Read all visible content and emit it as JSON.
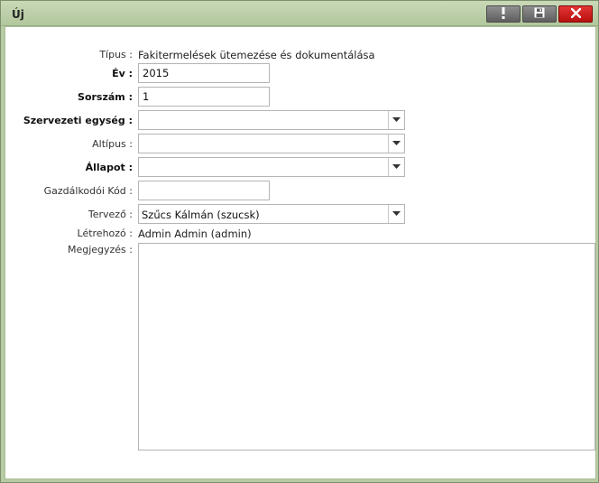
{
  "window": {
    "title": "Új"
  },
  "form": {
    "tipus": {
      "label": "Típus :",
      "value": "Fakitermelések ütemezése és dokumentálása"
    },
    "ev": {
      "label": "Év :",
      "value": "2015"
    },
    "sorszam": {
      "label": "Sorszám :",
      "value": "1"
    },
    "szervezeti_egyseg": {
      "label": "Szervezeti egység :",
      "value": ""
    },
    "altipus": {
      "label": "Altípus :",
      "value": ""
    },
    "allapot": {
      "label": "Állapot :",
      "value": ""
    },
    "gazdalkodoi_kod": {
      "label": "Gazdálkodói Kód :",
      "value": ""
    },
    "tervezo": {
      "label": "Tervező :",
      "value": "Szűcs Kálmán (szucsk)"
    },
    "letrehozo": {
      "label": "Létrehozó :",
      "value": "Admin Admin (admin)"
    },
    "megjegyzes": {
      "label": "Megjegyzés :",
      "value": ""
    }
  },
  "colors": {
    "titlebar": "#b7cca3",
    "close_button": "#d42020",
    "toolbar_button": "#6e6e6e"
  }
}
